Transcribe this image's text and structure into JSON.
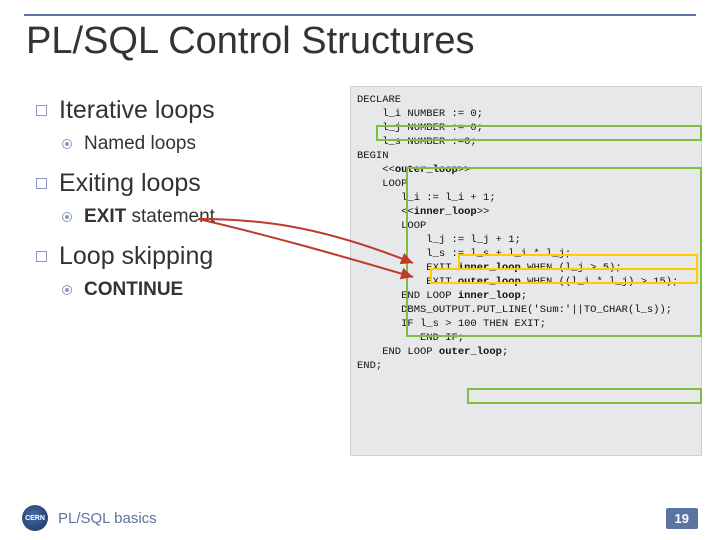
{
  "title": "PL/SQL Control Structures",
  "bullets": {
    "b1": "Iterative loops",
    "b1a": "Named loops",
    "b2": "Exiting loops",
    "b2a_pre": "EXIT",
    "b2a_post": " statement",
    "b3": "Loop skipping",
    "b3a": "CONTINUE"
  },
  "code": {
    "l01": "DECLARE",
    "l02": "    l_i NUMBER := 0;",
    "l03": "    l_j NUMBER := 0;",
    "l04": "    l_s NUMBER :=0;",
    "l05": "BEGIN",
    "l06a": "    <<",
    "l06b": "outer_loop",
    "l06c": ">>",
    "l07": "    LOOP",
    "l08": "       l_i := l_i + 1;",
    "l09a": "       <<",
    "l09b": "inner_loop",
    "l09c": ">>",
    "l10": "       LOOP",
    "l11": "           l_j := l_j + 1;",
    "l12": "           l_s := l_s + l_i * l_j;",
    "l13a": "           EXIT ",
    "l13b": "inner_loop",
    "l13c": " WHEN (l_j > 5);",
    "l14a": "           EXIT ",
    "l14b": "outer_loop",
    "l14c": " WHEN ((l_i * l_j) > 15);",
    "l15a": "       END LOOP ",
    "l15b": "inner_loop",
    "l15c": ";",
    "l16": "       DBMS_OUTPUT.PUT_LINE('Sum:'||TO_CHAR(l_s));",
    "l17": "       IF l_s > 100 THEN EXIT;",
    "l18": "          END IF;",
    "l19a": "    END LOOP ",
    "l19b": "outer_loop",
    "l19c": ";",
    "l20": "END;"
  },
  "footer": {
    "text": "PL/SQL basics",
    "logo": "CERN",
    "page": "19"
  }
}
